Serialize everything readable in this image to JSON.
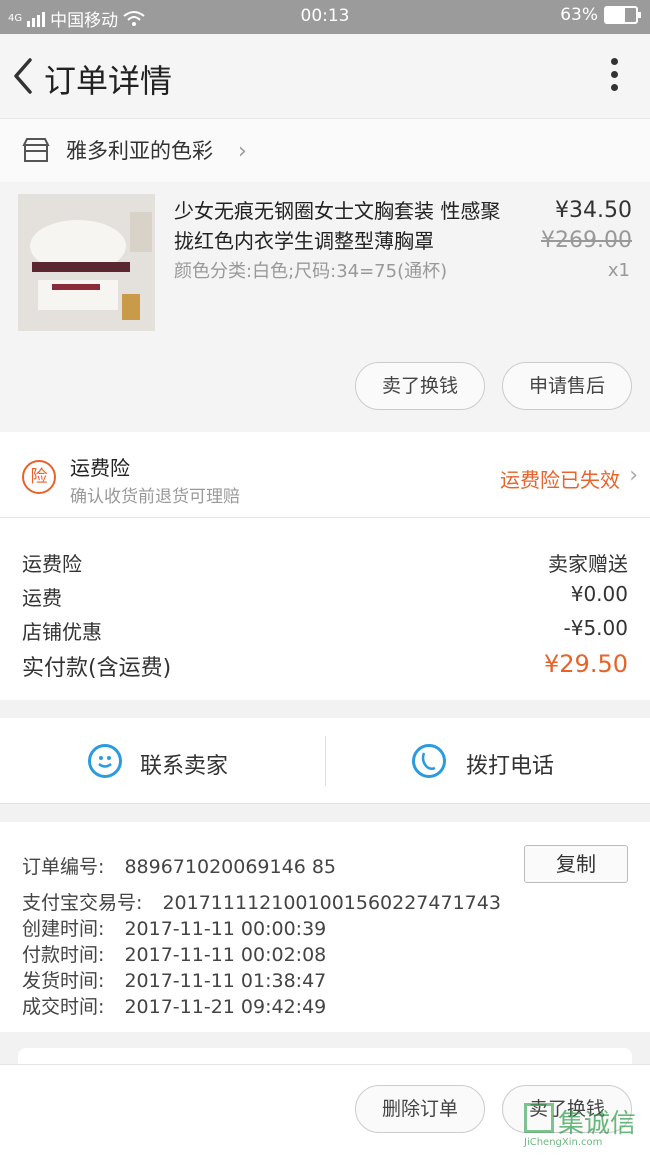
{
  "status_bar": {
    "network": "4G",
    "carrier": "中国移动",
    "time": "00:13",
    "battery": "63%",
    "battery_level": 0.63
  },
  "nav": {
    "title": "订单详情"
  },
  "shop": {
    "name": "雅多利亚的色彩"
  },
  "product": {
    "name": "少女无痕无钢圈女士文胸套装 性感聚拢红色内衣学生调整型薄胸罩",
    "sku": "颜色分类:白色;尺码:34=75(通杯)",
    "price": "¥34.50",
    "original_price": "¥269.00",
    "quantity": "x1",
    "buttons": {
      "refund": "卖了换钱",
      "after_sale": "申请售后"
    }
  },
  "insurance": {
    "badge": "险",
    "title": "运费险",
    "subtitle": "确认收货前退货可理赔",
    "status": "运费险已失效"
  },
  "fees": [
    {
      "label": "运费险",
      "value": "卖家赠送"
    },
    {
      "label": "运费",
      "value": "¥0.00"
    },
    {
      "label": "店铺优惠",
      "value": "-¥5.00"
    }
  ],
  "total": {
    "label": "实付款(含运费)",
    "value": "¥29.50"
  },
  "contact": {
    "seller": "联系卖家",
    "call": "拨打电话"
  },
  "order_info": {
    "order_no_label": "订单编号:",
    "order_no": "889671020069146 85",
    "copy": "复制",
    "alipay_label": "支付宝交易号:",
    "alipay_no": "2017111121001001560227471743",
    "created_label": "创建时间:",
    "created": "2017-11-11 00:00:39",
    "paid_label": "付款时间:",
    "paid": "2017-11-11 00:02:08",
    "shipped_label": "发货时间:",
    "shipped": "2017-11-11 01:38:47",
    "completed_label": "成交时间:",
    "completed": "2017-11-21 09:42:49"
  },
  "bottom": {
    "delete": "删除订单",
    "resell": "卖了换钱"
  },
  "watermark": {
    "text": "集诚信",
    "url": "JiChengXin.com"
  },
  "colors": {
    "accent": "#e8632b",
    "contact_icon": "#2b9be0",
    "status_bar": "#9b9b9b"
  }
}
